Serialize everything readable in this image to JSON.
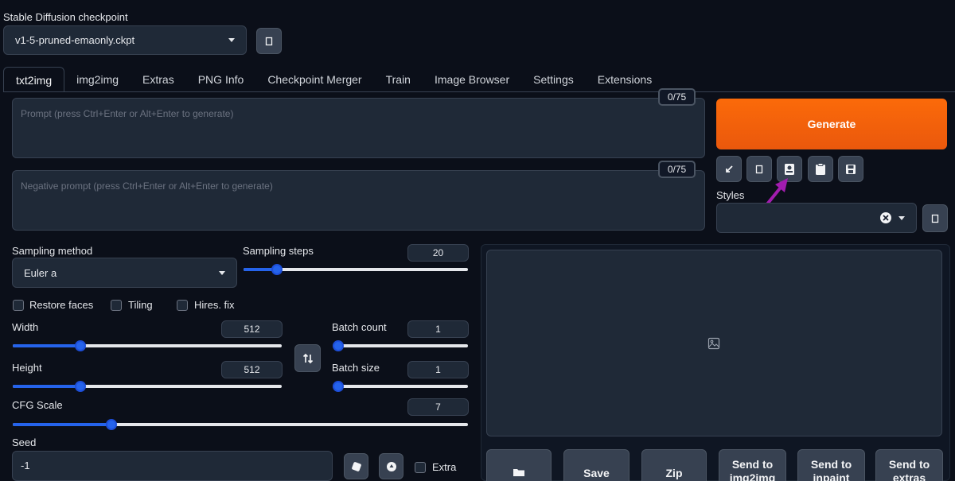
{
  "checkpoint": {
    "title": "Stable Diffusion checkpoint",
    "selected": "v1-5-pruned-emaonly.ckpt",
    "refresh_icon": "refresh-icon"
  },
  "tabs": [
    {
      "label": "txt2img",
      "active": true
    },
    {
      "label": "img2img"
    },
    {
      "label": "Extras"
    },
    {
      "label": "PNG Info"
    },
    {
      "label": "Checkpoint Merger"
    },
    {
      "label": "Train"
    },
    {
      "label": "Image Browser"
    },
    {
      "label": "Settings"
    },
    {
      "label": "Extensions"
    }
  ],
  "prompt": {
    "placeholder": "Prompt (press Ctrl+Enter or Alt+Enter to generate)",
    "counter": "0/75"
  },
  "negative_prompt": {
    "placeholder": "Negative prompt (press Ctrl+Enter or Alt+Enter to generate)",
    "counter": "0/75"
  },
  "generate_label": "Generate",
  "tool_icons": [
    "arrow-down-left-icon",
    "trash-icon",
    "card-icon",
    "clipboard-icon",
    "save-icon"
  ],
  "styles": {
    "label": "Styles",
    "value": ""
  },
  "sampling": {
    "method_label": "Sampling method",
    "method_value": "Euler a",
    "steps_label": "Sampling steps",
    "steps_value": "20",
    "steps_fraction": 0.13
  },
  "checkboxes": {
    "restore_faces": "Restore faces",
    "tiling": "Tiling",
    "hires_fix": "Hires. fix"
  },
  "width": {
    "label": "Width",
    "value": "512",
    "fraction": 0.24
  },
  "height": {
    "label": "Height",
    "value": "512",
    "fraction": 0.24
  },
  "batch_count": {
    "label": "Batch count",
    "value": "1",
    "fraction": 0.0
  },
  "batch_size": {
    "label": "Batch size",
    "value": "1",
    "fraction": 0.0
  },
  "cfg": {
    "label": "CFG Scale",
    "value": "7",
    "fraction": 0.21
  },
  "seed": {
    "label": "Seed",
    "value": "-1",
    "extra_label": "Extra"
  },
  "output_buttons": [
    {
      "label": "",
      "icon": "folder-icon"
    },
    {
      "label": "Save"
    },
    {
      "label": "Zip"
    },
    {
      "label": "Send to img2img"
    },
    {
      "label": "Send to inpaint"
    },
    {
      "label": "Send to extras"
    }
  ],
  "colors": {
    "accent": "#ea580c",
    "slider": "#2563eb",
    "arrow": "#a21caf"
  }
}
